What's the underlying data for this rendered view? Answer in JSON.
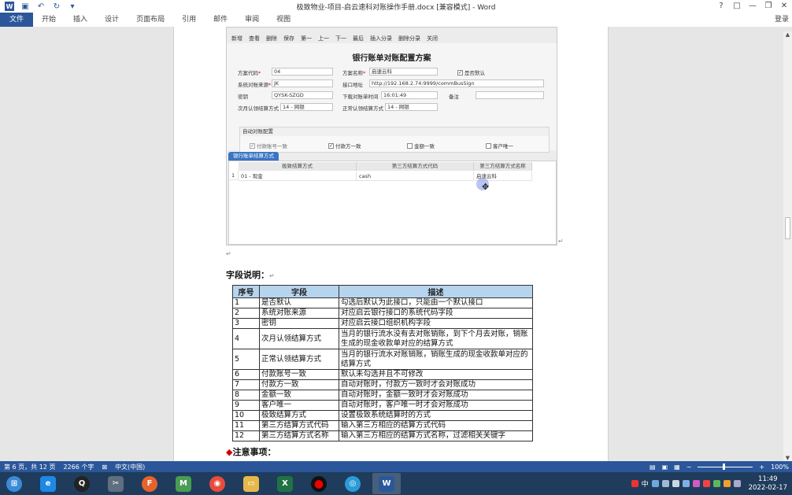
{
  "window": {
    "title": "极致物业-项目-启云速科对账操作手册.docx [兼容模式] - Word",
    "help": "?",
    "controls": [
      "□",
      "—",
      "❐",
      "✕"
    ],
    "login": "登录"
  },
  "ribbon": {
    "tabs": [
      "文件",
      "开始",
      "插入",
      "设计",
      "页面布局",
      "引用",
      "邮件",
      "审阅",
      "视图"
    ]
  },
  "embedded": {
    "toolbar": [
      "新增",
      "查看",
      "删除",
      "保存",
      "第一",
      "上一",
      "下一",
      "最后",
      "插入分录",
      "删除分录",
      "关闭"
    ],
    "form_title": "银行账单对账配置方案",
    "fields": {
      "scheme_code_label": "方案代码",
      "scheme_code_value": "04",
      "scheme_name_label": "方案名称",
      "scheme_name_value": "启速云科",
      "is_default_label": "是否默认",
      "source_label": "系统对账来源",
      "source_value": "JK",
      "api_label": "接口地址",
      "api_value": "http://192.168.2.74:9999/commBusSign",
      "key_label": "密钥",
      "key_value": "QYSK-SZGD",
      "download_time_label": "下载对账单时间",
      "download_time_value": "16:01:49",
      "remark_label": "备注",
      "next_month_label": "次月认领结算方式",
      "next_month_value": "14 - 网银",
      "normal_label": "正常认领结算方式",
      "normal_value": "14 - 网银"
    },
    "auto_group": {
      "title": "自动对账配置",
      "options": [
        "付款账号一致",
        "付款方一致",
        "金额一致",
        "客户唯一"
      ],
      "checked": [
        true,
        true,
        false,
        false
      ]
    },
    "subtab": "银行账单结算方式",
    "grid": {
      "headers": [
        "极致结算方式",
        "第三方结算方式代码",
        "第三方结算方式名称"
      ],
      "row_index": "1",
      "row": [
        "01 - 现金",
        "cash",
        "启速云科"
      ]
    }
  },
  "doc": {
    "heading": "字段说明：",
    "table_headers": [
      "序号",
      "字段",
      "描述"
    ],
    "rows": [
      [
        "1",
        "是否默认",
        "勾选后默认为此接口，只能由一个默认接口"
      ],
      [
        "2",
        "系统对账来源",
        "对应启云银行接口的系统代码字段"
      ],
      [
        "3",
        "密钥",
        "对应启云接口组织机构字段"
      ],
      [
        "4",
        "次月认领结算方式",
        "当月的银行流水没有去对账销账，到下个月去对账，销账生成的现金收款单对应的结算方式"
      ],
      [
        "5",
        "正常认领结算方式",
        "当月的银行流水对账销账，销账生成的现金收款单对应的结算方式"
      ],
      [
        "6",
        "付款账号一致",
        "默认未勾选并且不可修改"
      ],
      [
        "7",
        "付款方一致",
        "自动对账时，付款方一致时才会对账成功"
      ],
      [
        "8",
        "金额一致",
        "自动对账时，金额一致时才会对账成功"
      ],
      [
        "9",
        "客户唯一",
        "自动对账时，客户唯一时才会对账成功"
      ],
      [
        "10",
        "极致结算方式",
        "设置极致系统结算时的方式"
      ],
      [
        "11",
        "第三方结算方式代码",
        "输入第三方相应的结算方式代码"
      ],
      [
        "12",
        "第三方结算方式名称",
        "输入第三方相应的结算方式名称，过滤相关关键字"
      ]
    ],
    "notice": "注意事项：",
    "notice_marker": "◆",
    "para_mark": "↵"
  },
  "status": {
    "page": "第 6 页，共 12 页",
    "words": "2266 个字",
    "lang": "中文(中国)",
    "zoom": "100%"
  },
  "taskbar": {
    "apps": [
      "start",
      "ie",
      "qq",
      "tools",
      "firefox",
      "maps",
      "chrome",
      "folder",
      "excel",
      "record",
      "browser",
      "word"
    ],
    "time": "11:49",
    "date": "2022-02-17",
    "ime": "中"
  },
  "colors": {
    "word_blue": "#2b579a",
    "table_header": "#b6d4ee",
    "taskbar": "#1f3c5c"
  }
}
